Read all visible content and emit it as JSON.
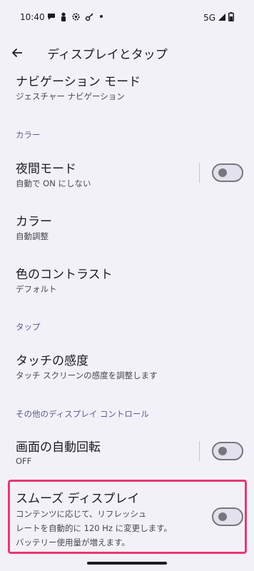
{
  "status_bar": {
    "time": "10:40",
    "network": "5G"
  },
  "app_bar": {
    "title": "ディスプレイとタップ"
  },
  "items": {
    "navigation_mode": {
      "title": "ナビゲーション モード",
      "subtitle": "ジェスチャー ナビゲーション"
    },
    "night_mode": {
      "title": "夜間モード",
      "subtitle": "自動で ON にしない",
      "enabled": false
    },
    "colors": {
      "title": "カラー",
      "subtitle": "自動調整"
    },
    "contrast": {
      "title": "色のコントラスト",
      "subtitle": "デフォルト"
    },
    "touch_sensitivity": {
      "title": "タッチの感度",
      "subtitle": "タッチ スクリーンの感度を調整します"
    },
    "auto_rotate": {
      "title": "画面の自動回転",
      "subtitle": "OFF",
      "enabled": false
    },
    "smooth_display": {
      "title": "スムーズ ディスプレイ",
      "description_lines": [
        "コンテンツに応じて、リフレッシュ",
        "レートを自動的に 120 Hz に変更します。",
        "バッテリー使用量が増えます。"
      ],
      "enabled": false
    }
  },
  "sections": {
    "color": "カラー",
    "tap": "タップ",
    "other_display_controls": "その他のディスプレイ コントロール"
  },
  "icons": {
    "back": "arrow-back-icon",
    "status": [
      "message-icon",
      "person-icon",
      "settings-icon",
      "key-icon",
      "dot-icon",
      "signal-icon",
      "battery-icon"
    ]
  },
  "colors": {
    "highlight": "#e7396f",
    "background": "#f2f1f8",
    "section_text": "#5a5a8a"
  }
}
